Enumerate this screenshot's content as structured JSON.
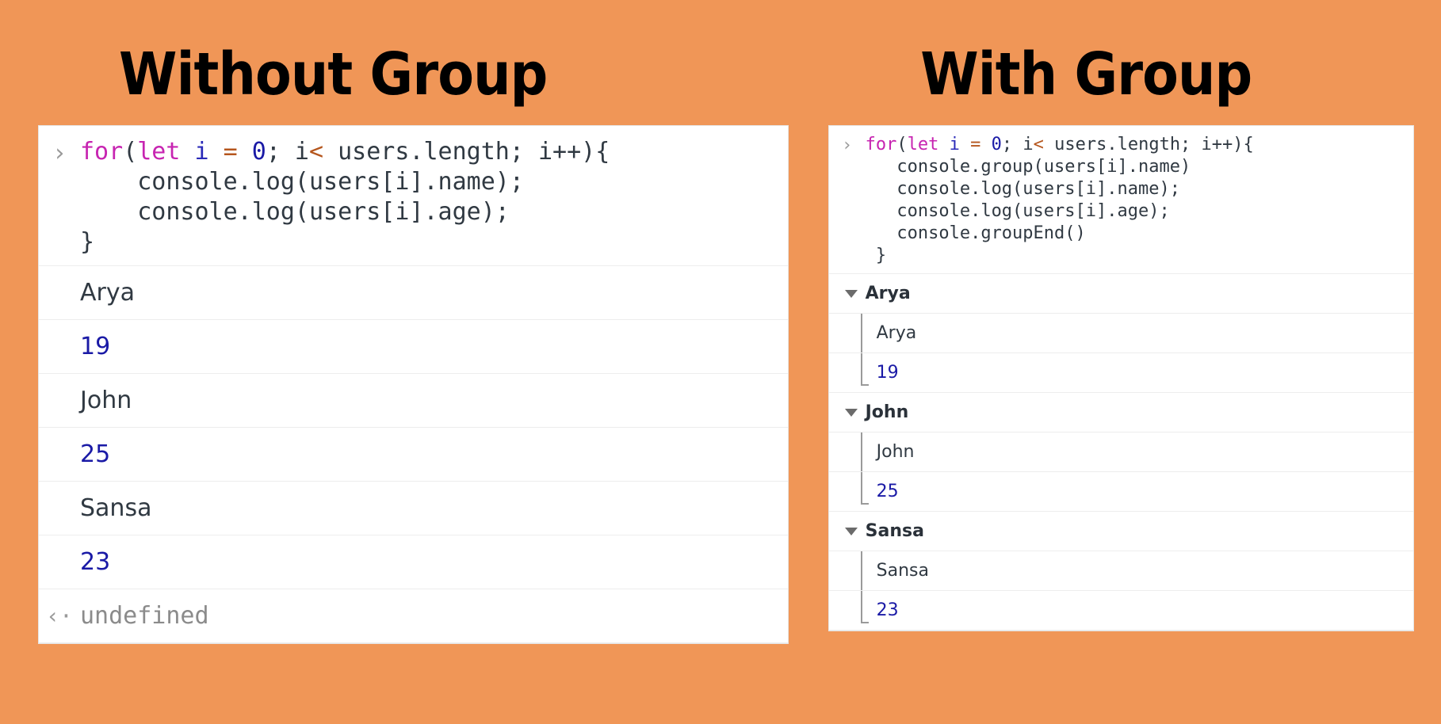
{
  "background_color": "#f09657",
  "panels": [
    {
      "id": "without-group",
      "title": "Without Group",
      "prompt_icon": "›",
      "code_lines": [
        [
          {
            "t": "for",
            "c": "kw"
          },
          {
            "t": "(",
            "c": "pl"
          },
          {
            "t": "let",
            "c": "kw"
          },
          {
            "t": " ",
            "c": "pl"
          },
          {
            "t": "i",
            "c": "var"
          },
          {
            "t": " ",
            "c": "pl"
          },
          {
            "t": "=",
            "c": "op"
          },
          {
            "t": " ",
            "c": "pl"
          },
          {
            "t": "0",
            "c": "num"
          },
          {
            "t": "; i",
            "c": "pl"
          },
          {
            "t": "<",
            "c": "op"
          },
          {
            "t": " users.length; i++){",
            "c": "pl"
          }
        ],
        [
          {
            "t": "    console.log(users[i].name);",
            "c": "pl"
          }
        ],
        [
          {
            "t": "    console.log(users[i].age);",
            "c": "pl"
          }
        ],
        [
          {
            "t": "}",
            "c": "pl"
          }
        ]
      ],
      "output_rows": [
        {
          "kind": "log",
          "text": "Arya",
          "type": "string"
        },
        {
          "kind": "log",
          "text": "19",
          "type": "number"
        },
        {
          "kind": "log",
          "text": "John",
          "type": "string"
        },
        {
          "kind": "log",
          "text": "25",
          "type": "number"
        },
        {
          "kind": "log",
          "text": "Sansa",
          "type": "string"
        },
        {
          "kind": "log",
          "text": "23",
          "type": "number"
        },
        {
          "kind": "return",
          "text": "undefined",
          "type": "undefined",
          "icon": "‹·"
        }
      ]
    },
    {
      "id": "with-group",
      "title": "With Group",
      "prompt_icon": "›",
      "code_lines": [
        [
          {
            "t": "for",
            "c": "kw"
          },
          {
            "t": "(",
            "c": "pl"
          },
          {
            "t": "let",
            "c": "kw"
          },
          {
            "t": " ",
            "c": "pl"
          },
          {
            "t": "i",
            "c": "var"
          },
          {
            "t": " ",
            "c": "pl"
          },
          {
            "t": "=",
            "c": "op"
          },
          {
            "t": " ",
            "c": "pl"
          },
          {
            "t": "0",
            "c": "num"
          },
          {
            "t": "; i",
            "c": "pl"
          },
          {
            "t": "<",
            "c": "op"
          },
          {
            "t": " users.length; i++){",
            "c": "pl"
          }
        ],
        [
          {
            "t": "   console.group(users[i].name)",
            "c": "pl"
          }
        ],
        [
          {
            "t": "   console.log(users[i].name);",
            "c": "pl"
          }
        ],
        [
          {
            "t": "   console.log(users[i].age);",
            "c": "pl"
          }
        ],
        [
          {
            "t": "   console.groupEnd()",
            "c": "pl"
          }
        ],
        [
          {
            "t": " }",
            "c": "pl"
          }
        ]
      ],
      "groups": [
        {
          "label": "Arya",
          "caret_icon": "caret-down-icon",
          "children": [
            {
              "text": "Arya",
              "type": "string"
            },
            {
              "text": "19",
              "type": "number"
            }
          ]
        },
        {
          "label": "John",
          "caret_icon": "caret-down-icon",
          "children": [
            {
              "text": "John",
              "type": "string"
            },
            {
              "text": "25",
              "type": "number"
            }
          ]
        },
        {
          "label": "Sansa",
          "caret_icon": "caret-down-icon",
          "children": [
            {
              "text": "Sansa",
              "type": "string"
            },
            {
              "text": "23",
              "type": "number"
            }
          ]
        }
      ]
    }
  ],
  "colors": {
    "keyword": "#c724b1",
    "number": "#1a1aa6",
    "operator": "#b5561d",
    "plain": "#303942",
    "muted": "#8b8b8b",
    "panel_bg": "#ffffff",
    "divider": "#ededed"
  }
}
